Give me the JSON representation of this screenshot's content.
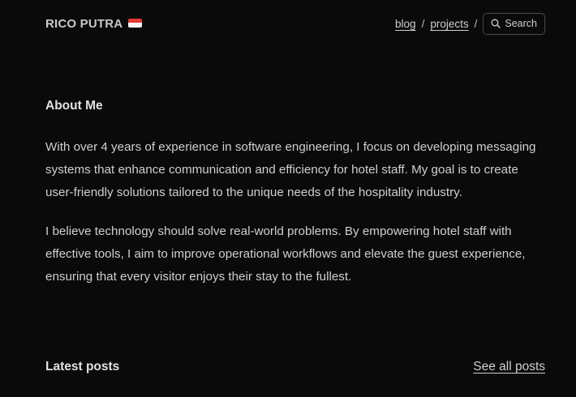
{
  "header": {
    "site_title": "RICO PUTRA",
    "flag_icon": "indonesia-flag-icon",
    "nav": {
      "blog": "blog",
      "separator": "/",
      "projects": "projects"
    },
    "search_label": "Search",
    "search_icon": "search-icon"
  },
  "about": {
    "heading": "About Me",
    "paragraph1": "With over 4 years of experience in software engineering, I focus on developing messaging systems that enhance communication and efficiency for hotel staff. My goal is to create user-friendly solutions tailored to the unique needs of the hospitality industry.",
    "paragraph2": "I believe technology should solve real-world problems. By empowering hotel staff with effective tools, I aim to improve operational workflows and elevate the guest experience, ensuring that every visitor enjoys their stay to the fullest."
  },
  "latest_posts": {
    "heading": "Latest posts",
    "see_all_label": "See all posts"
  },
  "colors": {
    "background": "#0a0a0a",
    "text": "#cfcfcf",
    "flag_red": "#e53935",
    "flag_white": "#f5f5f5"
  }
}
